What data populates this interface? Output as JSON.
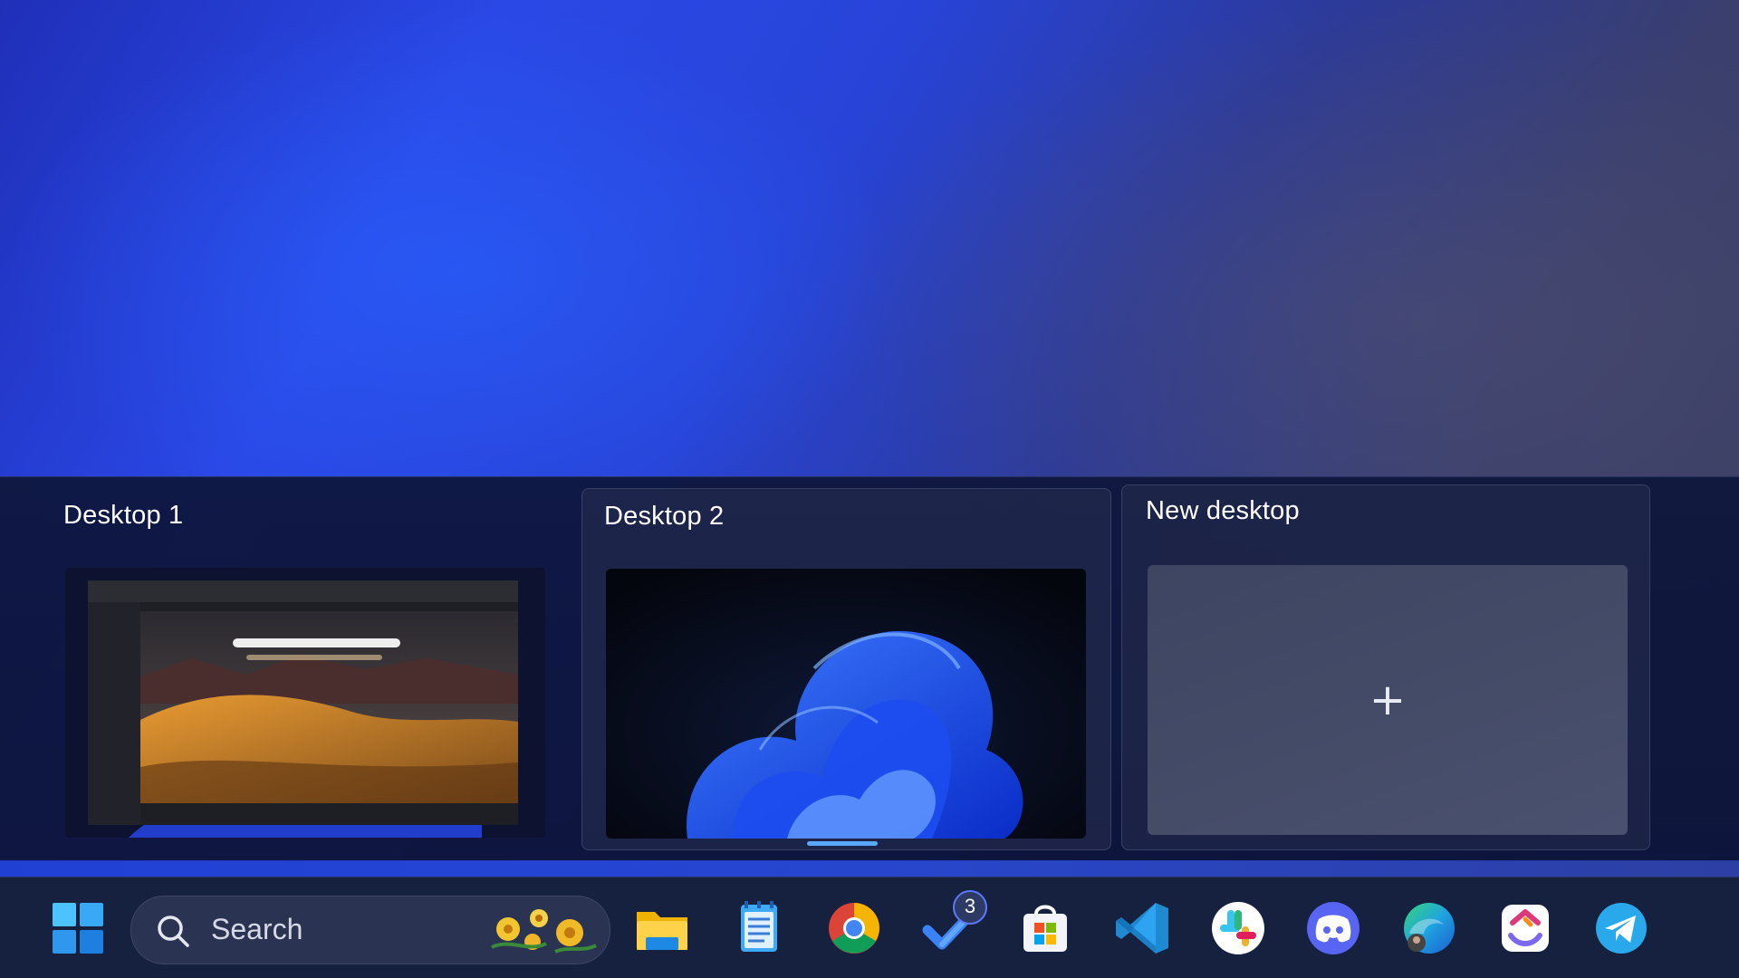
{
  "desktops": [
    {
      "label": "Desktop 1"
    },
    {
      "label": "Desktop 2"
    }
  ],
  "new_desktop": {
    "label": "New desktop",
    "icon": "plus-icon",
    "glyph": "+"
  },
  "taskbar": {
    "start_icon": "windows-start-icon",
    "search": {
      "label": "Search",
      "icon": "search-icon"
    },
    "apps": [
      {
        "name": "file-explorer"
      },
      {
        "name": "notepad"
      },
      {
        "name": "chrome"
      },
      {
        "name": "todo",
        "badge": "3"
      },
      {
        "name": "microsoft-store"
      },
      {
        "name": "vscode"
      },
      {
        "name": "slack"
      },
      {
        "name": "discord"
      },
      {
        "name": "edge"
      },
      {
        "name": "clickup"
      },
      {
        "name": "telegram"
      }
    ]
  },
  "colors": {
    "accent": "#5aa8ff",
    "panel": "#0e163c",
    "taskbar": "#16203f"
  }
}
